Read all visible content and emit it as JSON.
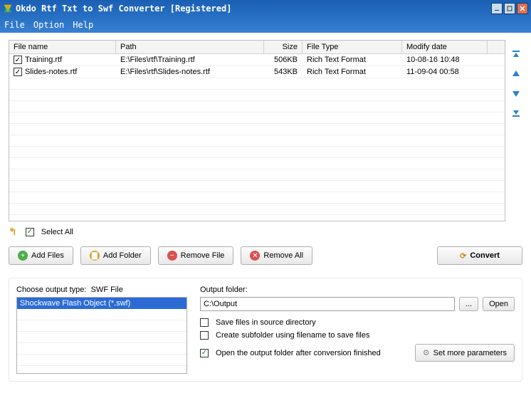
{
  "window": {
    "title": "Okdo Rtf Txt to Swf Converter [Registered]"
  },
  "menu": {
    "file": "File",
    "option": "Option",
    "help": "Help"
  },
  "grid": {
    "headers": {
      "name": "File name",
      "path": "Path",
      "size": "Size",
      "type": "File Type",
      "date": "Modify date"
    },
    "rows": [
      {
        "checked": true,
        "name": "Training.rtf",
        "path": "E:\\Files\\rtf\\Training.rtf",
        "size": "506KB",
        "type": "Rich Text Format",
        "date": "10-08-16 10:48"
      },
      {
        "checked": true,
        "name": "Slides-notes.rtf",
        "path": "E:\\Files\\rtf\\Slides-notes.rtf",
        "size": "543KB",
        "type": "Rich Text Format",
        "date": "11-09-04 00:58"
      }
    ]
  },
  "selectAll": {
    "label": "Select All",
    "checked": true
  },
  "buttons": {
    "addFiles": "Add Files",
    "addFolder": "Add Folder",
    "removeFile": "Remove File",
    "removeAll": "Remove All",
    "convert": "Convert"
  },
  "outputType": {
    "label": "Choose output type:",
    "value": "SWF File",
    "options": [
      "Shockwave Flash Object (*.swf)"
    ]
  },
  "outputFolder": {
    "label": "Output folder:",
    "path": "C:\\Output",
    "browse": "...",
    "open": "Open",
    "opt1": {
      "label": "Save files in source directory",
      "checked": false
    },
    "opt2": {
      "label": "Create subfolder using filename to save files",
      "checked": false
    },
    "opt3": {
      "label": "Open the output folder after conversion finished",
      "checked": true
    },
    "more": "Set more parameters"
  }
}
